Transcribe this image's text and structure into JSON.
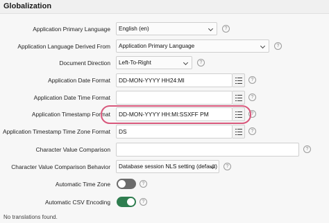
{
  "section": {
    "title": "Globalization"
  },
  "fields": {
    "primary_language": {
      "label": "Application Primary Language",
      "value": "English (en)"
    },
    "derived_from": {
      "label": "Application Language Derived From",
      "value": "Application Primary Language"
    },
    "document_direction": {
      "label": "Document Direction",
      "value": "Left-To-Right"
    },
    "date_format": {
      "label": "Application Date Format",
      "value": "DD-MON-YYYY HH24:MI"
    },
    "date_time_format": {
      "label": "Application Date Time Format",
      "value": ""
    },
    "timestamp_format": {
      "label": "Application Timestamp Format",
      "value": "DD-MON-YYYY HH:MI:SSXFF PM"
    },
    "timestamp_tz_format": {
      "label": "Application Timestamp Time Zone Format",
      "value": "DS"
    },
    "char_value_comparison": {
      "label": "Character Value Comparison",
      "value": ""
    },
    "char_value_comparison_behavior": {
      "label": "Character Value Comparison Behavior",
      "value": "Database session NLS setting (default)"
    },
    "automatic_time_zone": {
      "label": "Automatic Time Zone",
      "value": "off"
    },
    "automatic_csv_encoding": {
      "label": "Automatic CSV Encoding",
      "value": "on"
    }
  },
  "help_glyph": "?",
  "footer": {
    "text": "No translations found."
  },
  "colors": {
    "toggle_on": "#2e7d4f",
    "toggle_off": "#6b6b6b",
    "highlight": "#d8577b"
  }
}
